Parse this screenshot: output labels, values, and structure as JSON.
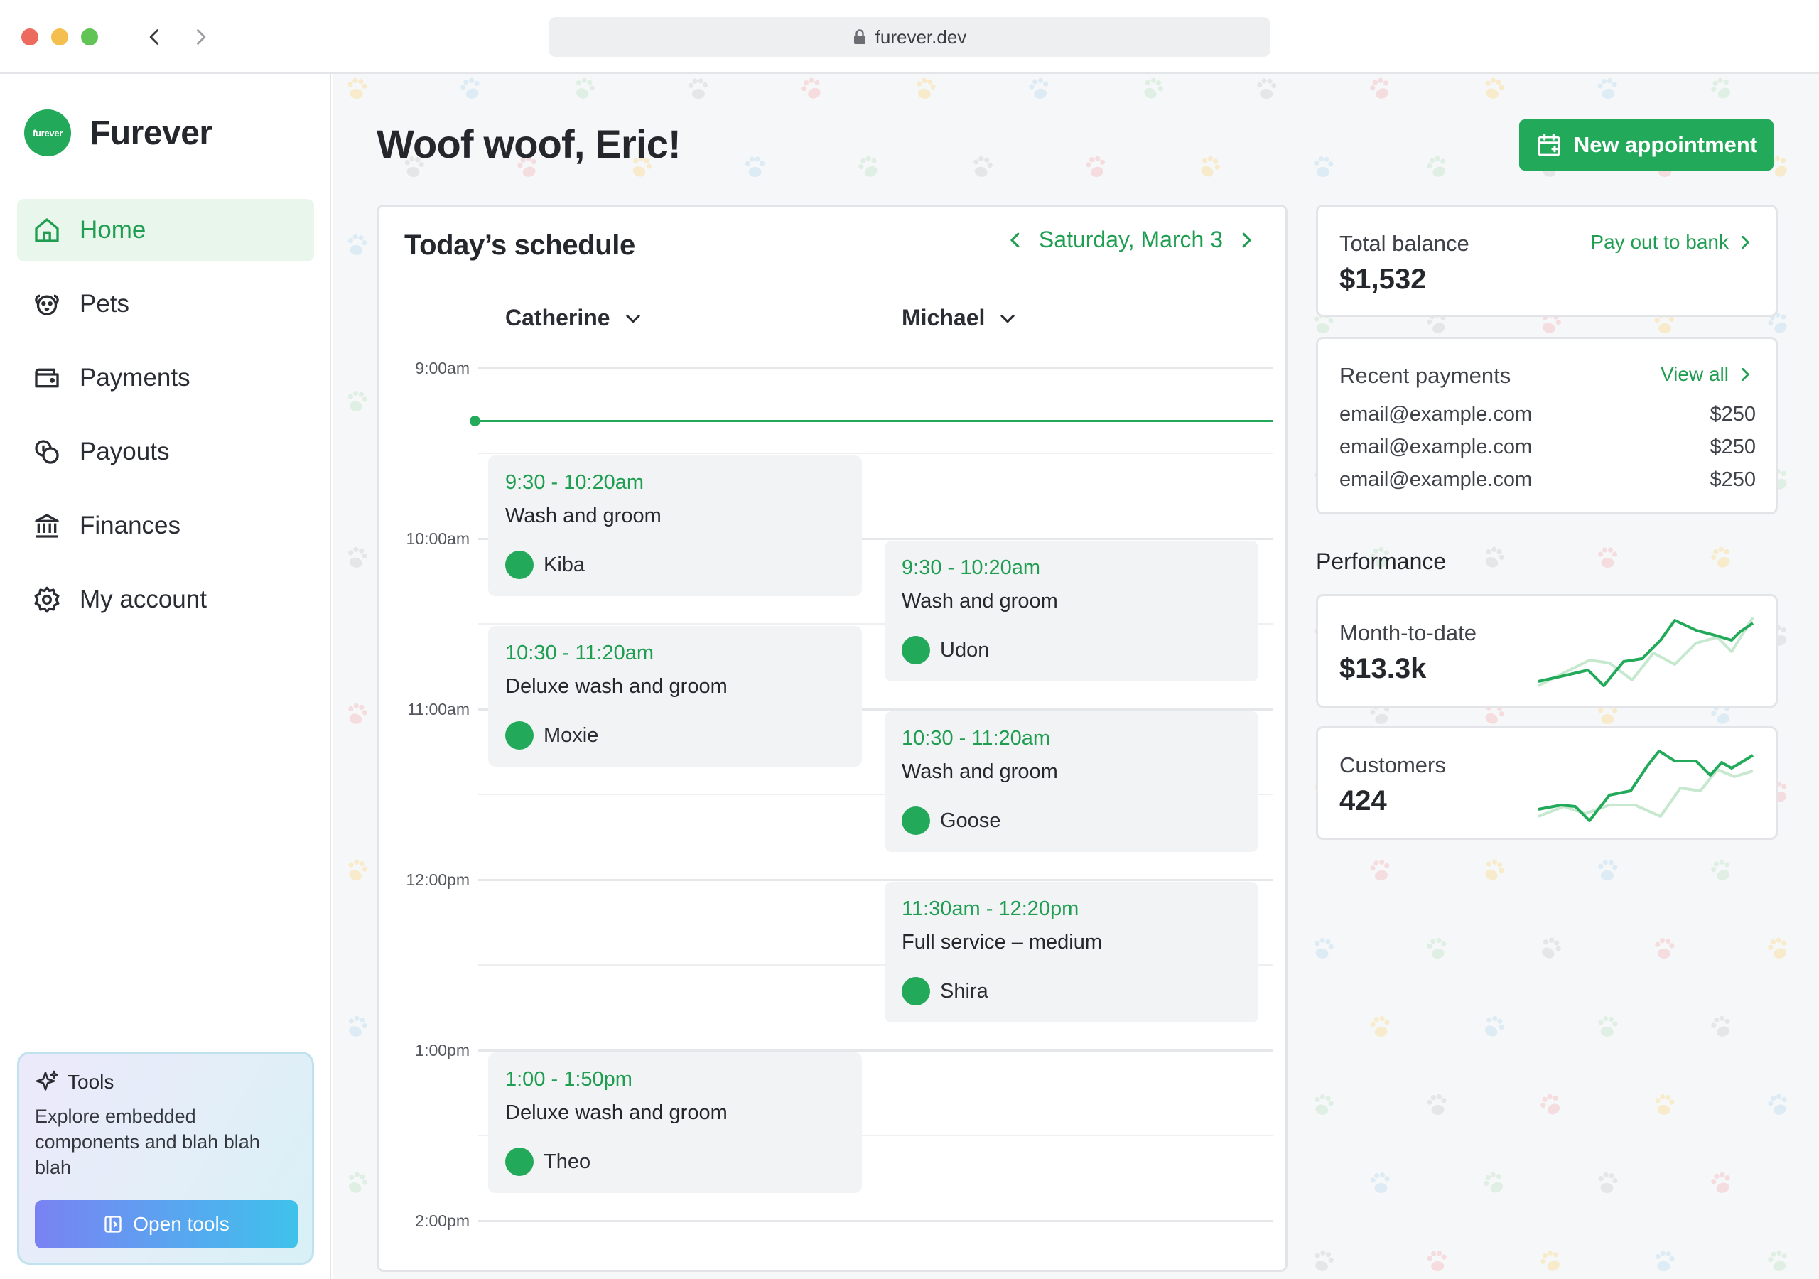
{
  "browser": {
    "url": "furever.dev"
  },
  "brand": {
    "logo_text": "furever",
    "name": "Furever"
  },
  "sidebar": {
    "items": [
      {
        "label": "Home",
        "icon": "home-icon",
        "active": true
      },
      {
        "label": "Pets",
        "icon": "pet-icon"
      },
      {
        "label": "Payments",
        "icon": "wallet-icon"
      },
      {
        "label": "Payouts",
        "icon": "coins-icon"
      },
      {
        "label": "Finances",
        "icon": "bank-icon"
      },
      {
        "label": "My account",
        "icon": "gear-icon"
      }
    ],
    "tools": {
      "title": "Tools",
      "description": "Explore embedded components and blah blah blah",
      "button_label": "Open tools"
    }
  },
  "header": {
    "greeting": "Woof woof, Eric!",
    "new_appointment_label": "New appointment"
  },
  "schedule": {
    "title": "Today’s schedule",
    "date": "Saturday, March 3",
    "staff": [
      "Catherine",
      "Michael"
    ],
    "hours": [
      "9:00am",
      "10:00am",
      "11:00am",
      "12:00pm",
      "1:00pm",
      "2:00pm"
    ],
    "appointments": [
      {
        "time": "9:30 - 10:20am",
        "service": "Wash and groom",
        "pet": "Kiba"
      },
      {
        "time": "10:30 - 11:20am",
        "service": "Deluxe wash and groom",
        "pet": "Moxie"
      },
      {
        "time": "1:00 - 1:50pm",
        "service": "Deluxe wash and groom",
        "pet": "Theo"
      },
      {
        "time": "9:30 - 10:20am",
        "service": "Wash and groom",
        "pet": "Udon"
      },
      {
        "time": "10:30 - 11:20am",
        "service": "Wash and groom",
        "pet": "Goose"
      },
      {
        "time": "11:30am - 12:20pm",
        "service": "Full service – medium",
        "pet": "Shira"
      }
    ]
  },
  "balance": {
    "label": "Total balance",
    "value": "$1,532",
    "link": "Pay out to bank"
  },
  "recent_payments": {
    "label": "Recent payments",
    "link": "View all",
    "rows": [
      {
        "email": "email@example.com",
        "amount": "$250"
      },
      {
        "email": "email@example.com",
        "amount": "$250"
      },
      {
        "email": "email@example.com",
        "amount": "$250"
      }
    ]
  },
  "performance": {
    "title": "Performance",
    "metrics": [
      {
        "label": "Month-to-date",
        "value": "$13.3k"
      },
      {
        "label": "Customers",
        "value": "424"
      }
    ]
  },
  "colors": {
    "accent": "#22a95a",
    "accent_light": "#e8f6ec",
    "spark_secondary": "#c6e8cf"
  }
}
